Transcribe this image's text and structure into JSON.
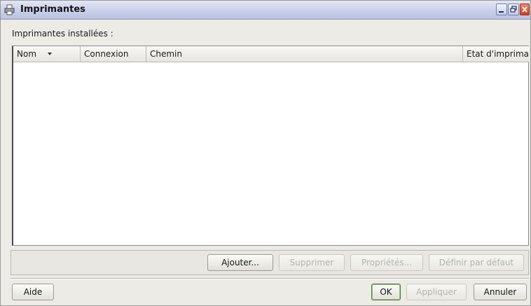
{
  "window": {
    "title": "Imprimantes"
  },
  "group_label": "Imprimantes installées :",
  "table": {
    "columns": [
      "Nom",
      "Connexion",
      "Chemin",
      "Etat d'imprima"
    ],
    "rows": []
  },
  "actions": {
    "add": "Ajouter...",
    "delete": "Supprimer",
    "properties": "Propriétés...",
    "set_default": "Définir par défaut"
  },
  "footer": {
    "help": "Aide",
    "ok": "OK",
    "apply": "Appliquer",
    "cancel": "Annuler"
  }
}
